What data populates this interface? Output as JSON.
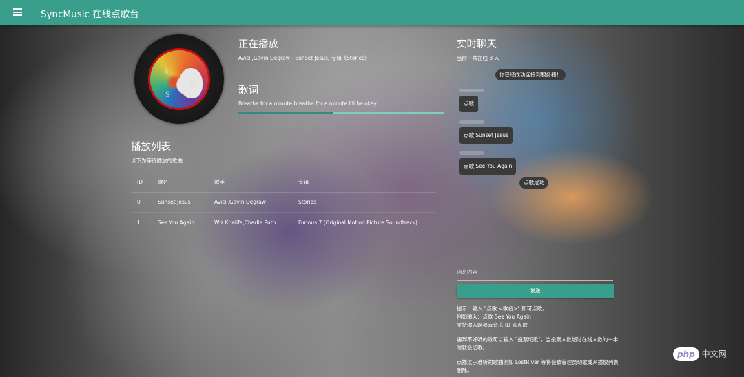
{
  "app": {
    "title": "SyncMusic 在线点歌台"
  },
  "now_playing": {
    "heading": "正在播放",
    "info": "Avicii,Gavin Degraw - Sunset Jesus, 专辑《Stories》",
    "progress": 0.46
  },
  "lyrics": {
    "heading": "歌词",
    "current_line": "Breathe for a minute breathe for a minute I'll be okay"
  },
  "playlist": {
    "heading": "播放列表",
    "subtitle": "以下为等待播放的歌曲",
    "columns": [
      "ID",
      "歌名",
      "歌手",
      "专辑"
    ],
    "rows": [
      {
        "id": "0",
        "name": "Sunset Jesus",
        "artist": "Avicii,Gavin Degraw",
        "album": "Stories"
      },
      {
        "id": "1",
        "name": "See You Again",
        "artist": "Wiz Khalifa,Charlie Puth",
        "album": "Furious 7 (Original Motion Picture Soundtrack)"
      }
    ]
  },
  "chat": {
    "heading": "实时聊天",
    "online": "当前一共在线 3 人",
    "system_msg_1": "你已经成功连接到服务器！",
    "messages": [
      "点歌",
      "点歌 Sunset Jesus",
      "点歌 See You Again"
    ],
    "system_msg_2": "点歌成功",
    "input_placeholder": "消息内容",
    "send_label": "发送",
    "tips": [
      "提示：输入 \"点歌 <歌名>\" 即可点歌。",
      "例如输入：点歌 See You Again",
      "支持输入网易云音乐 ID 来点歌",
      "遇到不好听的歌可以输入 \"投票切歌\"，当投票人数超过在线人数的一半时就会切歌。",
      "点播过于难听的歌曲例如 LostRiver 等将会被管理员切歌或从播放列表删除。"
    ]
  },
  "watermark": {
    "logo": "php",
    "text": "中文网"
  },
  "colors": {
    "accent": "#3a9e8c",
    "disc_ring": "#c81010"
  }
}
